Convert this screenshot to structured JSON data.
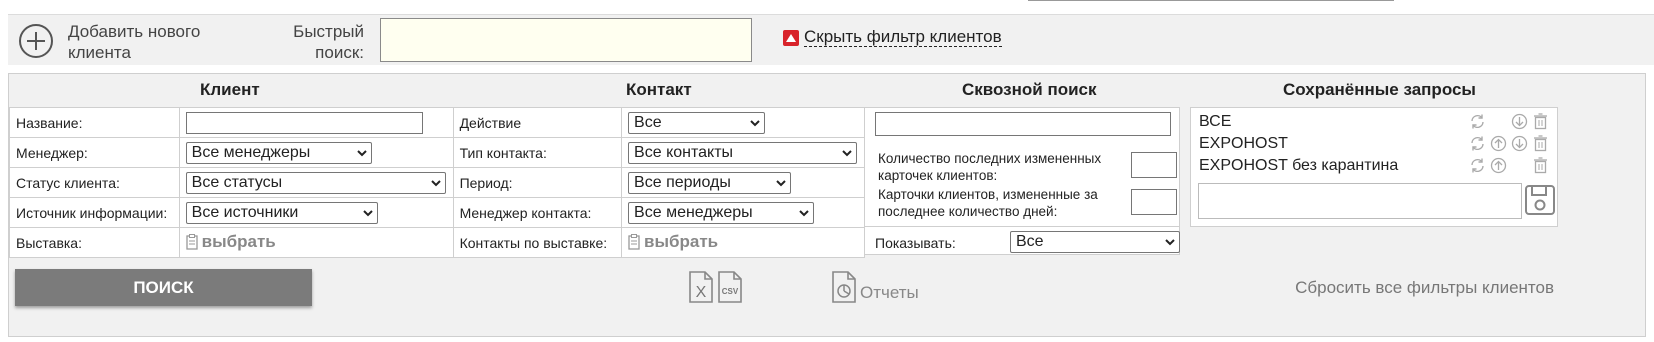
{
  "topbar": {
    "add_client": "Добавить нового клиента",
    "quick_search_label": "Быстрый поиск:",
    "quick_search_value": "",
    "hide_filter": "Скрыть фильтр клиентов"
  },
  "sections": {
    "client": "Клиент",
    "contact": "Контакт",
    "cross_search": "Сквозной поиск",
    "saved_queries": "Сохранённые запросы"
  },
  "client": {
    "name_label": "Название:",
    "manager_label": "Менеджер:",
    "manager_value": "Все менеджеры",
    "status_label": "Статус клиента:",
    "status_value": "Все статусы",
    "source_label": "Источник информации:",
    "source_value": "Все источники",
    "exhibition_label": "Выставка:",
    "exhibition_choose": "выбрать"
  },
  "contact": {
    "action_label": "Действие",
    "action_value": "Все",
    "type_label": "Тип контакта:",
    "type_value": "Все контакты",
    "period_label": "Период:",
    "period_value": "Все периоды",
    "manager_label": "Менеджер контакта:",
    "manager_value": "Все менеджеры",
    "by_exhibition_label": "Контакты по выставке:",
    "by_exhibition_choose": "выбрать"
  },
  "cross_search": {
    "last_changed_label": "Количество последних измененных карточек клиентов:",
    "changed_days_label": "Карточки клиентов, измененные за последнее количество дней:",
    "show_label": "Показывать:",
    "show_value": "Все"
  },
  "saved_queries": {
    "items": [
      {
        "name": "ВСЕ"
      },
      {
        "name": "EXPOHOST"
      },
      {
        "name": "EXPOHOST без карантина"
      }
    ]
  },
  "actions": {
    "search": "ПОИСК",
    "reports": "Отчеты",
    "reset": "Сбросить все фильтры клиентов"
  },
  "colors": {
    "accent_red": "#d8232a",
    "button_gray": "#7b7b7b",
    "panel_bg": "#f1f1f1",
    "quick_search_bg": "#fffff0"
  }
}
